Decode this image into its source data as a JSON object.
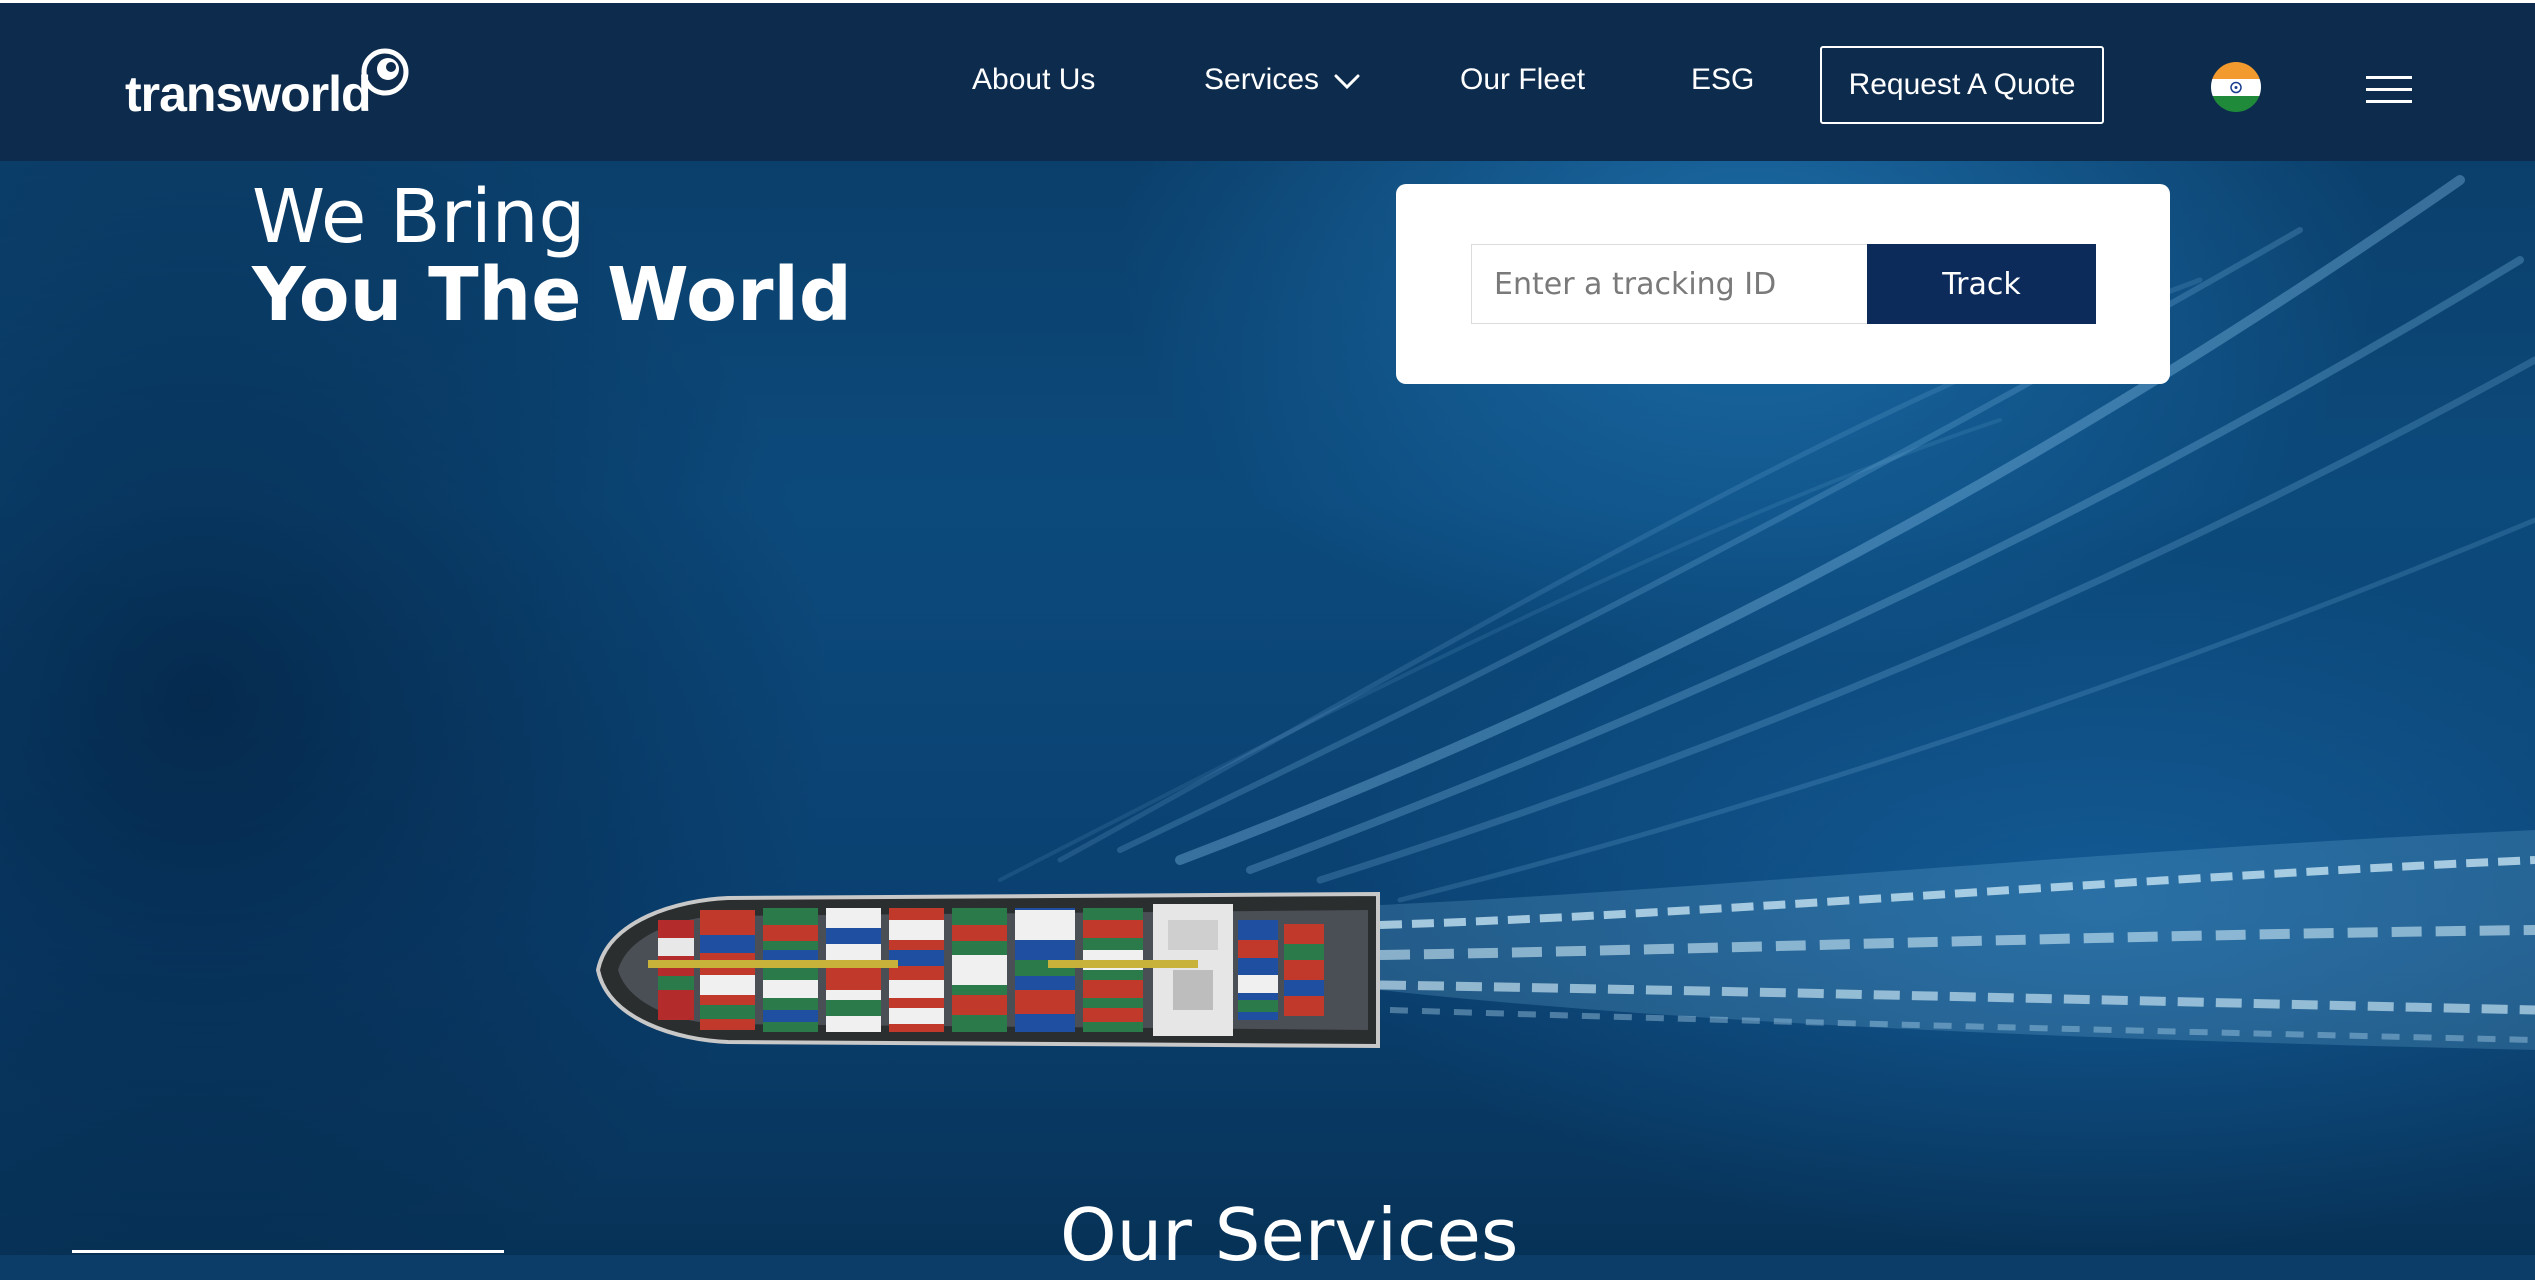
{
  "header": {
    "logo_text": "transworld",
    "nav": {
      "about": "About Us",
      "services": "Services",
      "fleet": "Our Fleet",
      "esg": "ESG"
    },
    "quote_button": "Request A Quote",
    "icons": [
      "chevron-down-icon",
      "india-flag-icon",
      "hamburger-menu-icon"
    ]
  },
  "hero": {
    "headline_line1": "We Bring",
    "headline_line2": "You The World"
  },
  "tracking": {
    "placeholder": "Enter a tracking ID",
    "value": "",
    "button": "Track"
  },
  "section": {
    "title": "Our Services"
  },
  "colors": {
    "nav_bg": "#0d2b4c",
    "ocean": "#0c4a7c",
    "track_button": "#0d2b5a",
    "text_light": "#ffffff"
  }
}
